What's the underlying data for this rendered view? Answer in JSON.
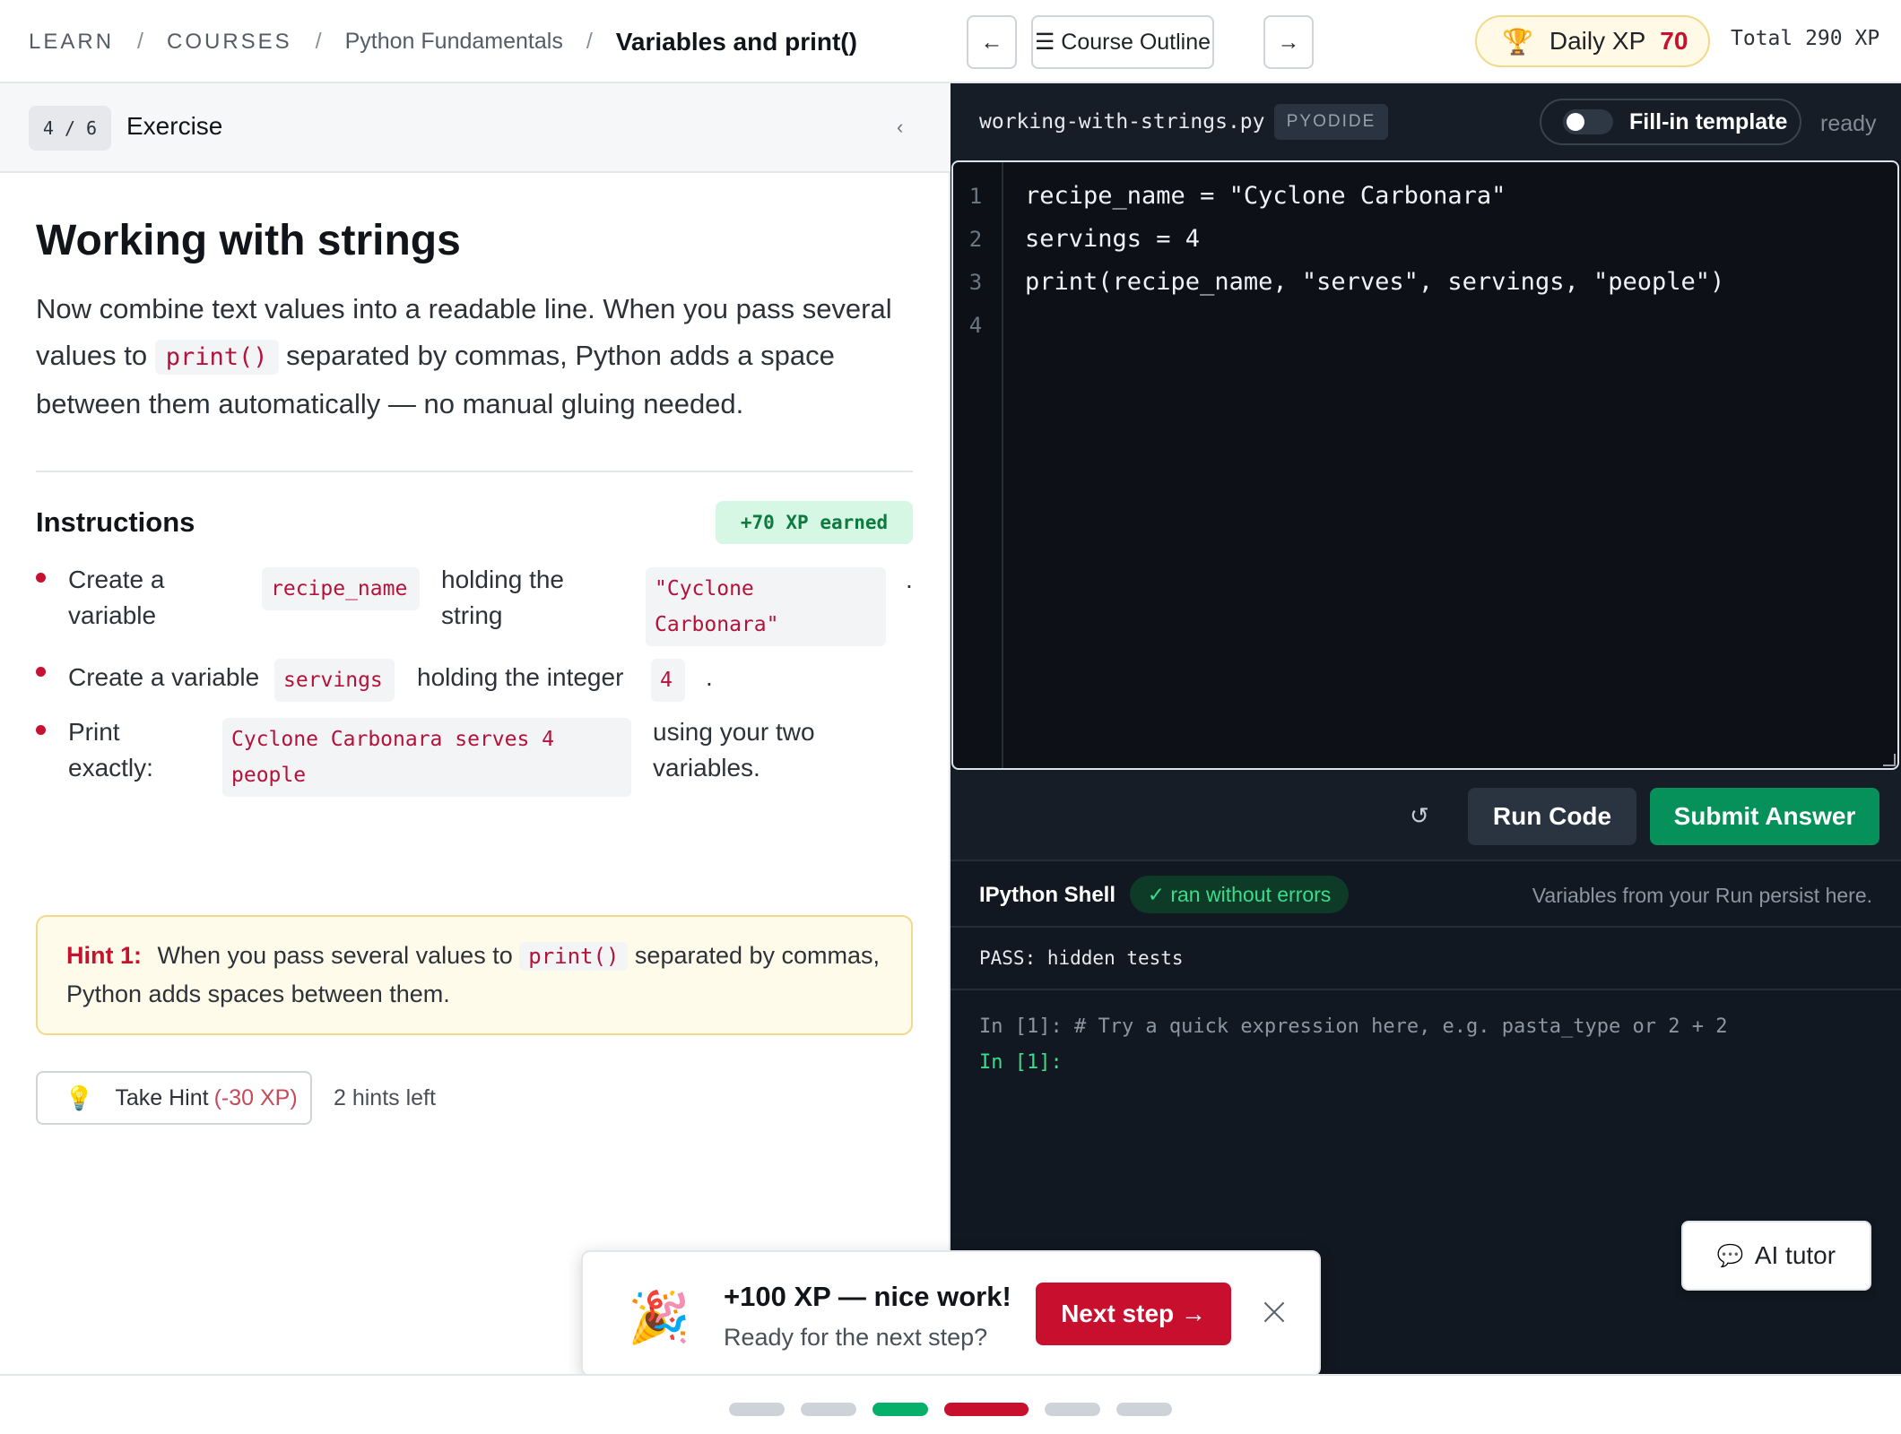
{
  "breadcrumb": {
    "learn": "LEARN",
    "courses": "COURSES",
    "course": "Python Fundamentals",
    "lesson": "Variables and print()",
    "separator": "/"
  },
  "nav": {
    "prev": "←",
    "outline": "☰ Course Outline",
    "next": "→"
  },
  "xp": {
    "daily_label": "Daily XP",
    "daily_value": "70",
    "total": "Total 290 XP"
  },
  "exercise": {
    "step": "4 / 6",
    "label": "Exercise",
    "collapse": "‹",
    "title": "Working with strings",
    "intro_1": "Now combine text values into a readable line. When you pass several values to",
    "intro_code": "print()",
    "intro_2": "separated by commas, Python adds a space between them automatically — no manual gluing needed."
  },
  "instructions": {
    "title": "Instructions",
    "earned": "+70 XP earned",
    "item1": {
      "a": "Create a variable",
      "code1": "recipe_name",
      "b": "holding the string",
      "code2": "\"Cyclone Carbonara\"",
      "end": "."
    },
    "item2": {
      "a": "Create a variable",
      "code1": "servings",
      "b": "holding the integer",
      "code2": "4",
      "end": "."
    },
    "item3": {
      "a": "Print exactly:",
      "code1": "Cyclone Carbonara serves 4 people",
      "b": "using your two variables."
    }
  },
  "hint": {
    "label": "Hint 1:",
    "text_1": "When you pass several values to",
    "code": "print()",
    "text_2": "separated by commas, Python adds spaces between them.",
    "take_label": "Take Hint",
    "take_cost": "(-30 XP)",
    "left": "2 hints left"
  },
  "editor": {
    "filename": "working-with-strings.py",
    "runtime": "PYODIDE",
    "template_toggle": "Fill-in template",
    "template_on": false,
    "status": "ready",
    "line_numbers": [
      "1",
      "2",
      "3",
      "4"
    ],
    "lines": [
      "recipe_name = \"Cyclone Carbonara\"",
      "servings = 4",
      "print(recipe_name, \"serves\", servings, \"people\")",
      ""
    ]
  },
  "actions": {
    "reset": "↺",
    "run": "Run Code",
    "submit": "Submit Answer"
  },
  "shell": {
    "title": "IPython Shell",
    "status": "✓ ran without errors",
    "note": "Variables from your Run persist here.",
    "result": "PASS: hidden tests",
    "history": "In [1]: # Try a quick expression here, e.g. pasta_type or 2 + 2",
    "prompt": "In [1]:"
  },
  "ai_tutor": "AI tutor",
  "toast": {
    "title": "+100 XP — nice work!",
    "subtitle": "Ready for the next step?",
    "next": "Next step →"
  },
  "progress": {
    "total_steps": 6,
    "current_step": 4,
    "completed_step": 3,
    "colors": {
      "pending": "#ced3d9",
      "done": "#06b06b",
      "current": "#c8102e"
    }
  },
  "icons": {
    "trophy": "🏆",
    "bulb": "💡",
    "party": "🎉",
    "chat": "💬"
  }
}
